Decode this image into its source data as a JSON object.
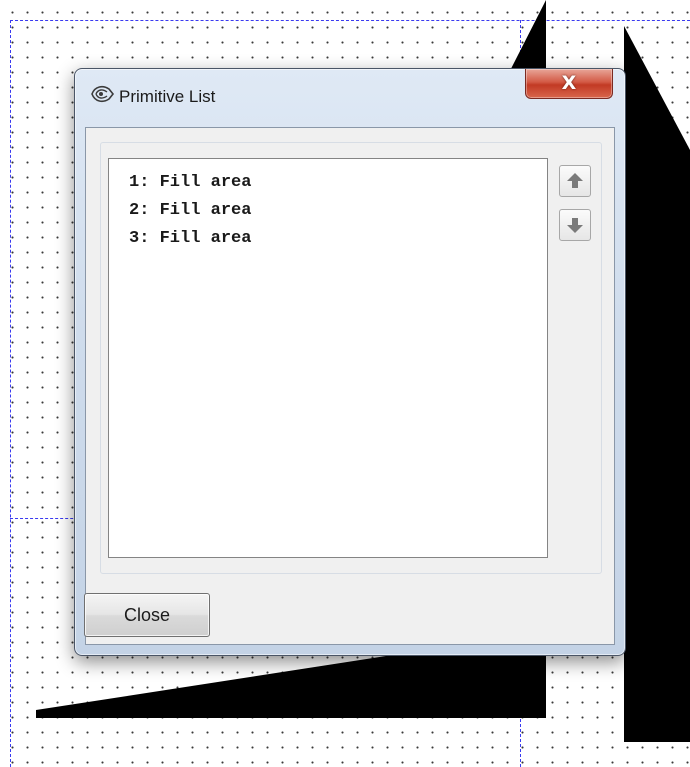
{
  "window": {
    "title": "Primitive List",
    "close_glyph": "X"
  },
  "list": {
    "items": [
      {
        "label": "1: Fill area"
      },
      {
        "label": "2: Fill area"
      },
      {
        "label": "3: Fill area"
      }
    ]
  },
  "controls": {
    "move_up_icon": "arrow-up-icon",
    "move_down_icon": "arrow-down-icon",
    "close_button": "Close"
  },
  "colors": {
    "guide": "#3a3af0",
    "shape_fill": "#000000",
    "close_x_red": "#c23a24"
  }
}
